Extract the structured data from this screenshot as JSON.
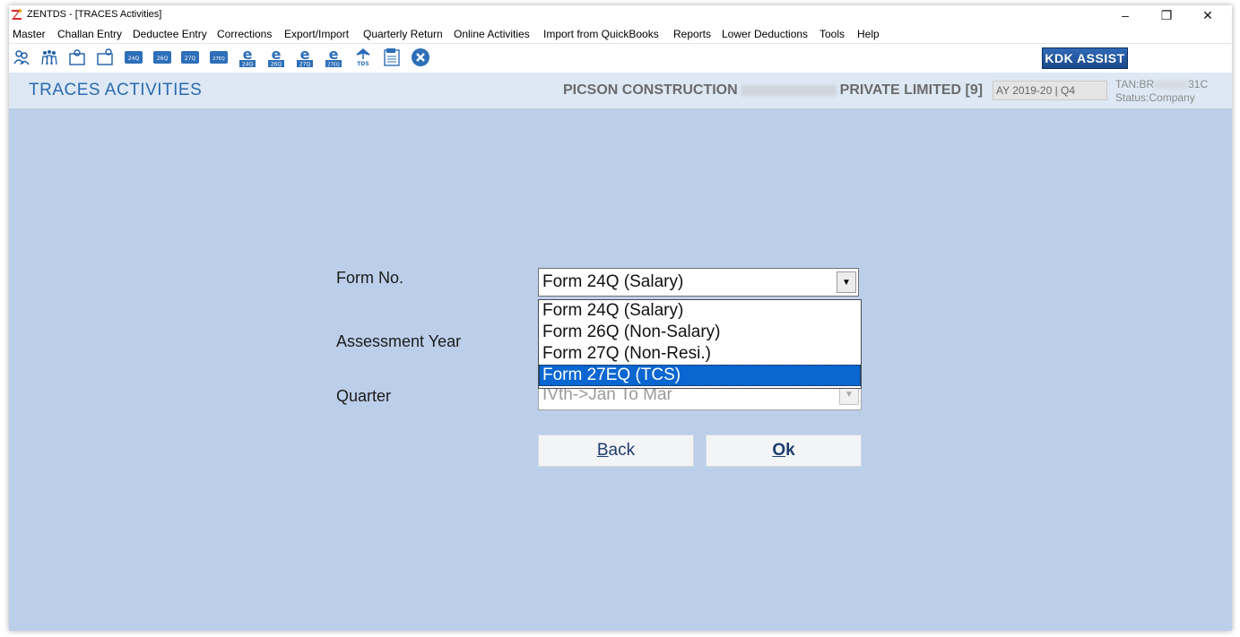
{
  "window": {
    "title": "ZENTDS - [TRACES Activities]",
    "controls": {
      "minimize": "–",
      "restore": "❐",
      "close": "✕"
    }
  },
  "menu": [
    "Master",
    "Challan Entry",
    "Deductee Entry",
    "Corrections",
    "Export/Import",
    "Quarterly Return",
    "Online Activities",
    "Import from QuickBooks",
    "Reports",
    "Lower Deductions",
    "Tools",
    "Help"
  ],
  "toolbar": {
    "icons": [
      "users-icon",
      "group-icon",
      "deductor-icon",
      "deductor-alt-icon",
      "form-24q-icon",
      "form-26q-icon",
      "form-27q-icon",
      "form-27eq-icon",
      "e-24q-icon",
      "e-26q-icon",
      "e-27q-icon",
      "e-27eq-icon",
      "tds-icon",
      "pdf-report-icon",
      "close-circle-icon"
    ],
    "icon_labels": [
      "",
      "",
      "",
      "",
      "24Q",
      "26Q",
      "27Q",
      "27EQ",
      "24Q",
      "26Q",
      "27Q",
      "27EQ",
      "TDS",
      "",
      ""
    ],
    "kdk_assist": "KDK ASSIST"
  },
  "header": {
    "page_title": "TRACES ACTIVITIES",
    "company_prefix": "PICSON CONSTRUCTION",
    "company_suffix": "PRIVATE LIMITED [9]",
    "ay_quarter": "AY 2019-20 | Q4",
    "tan_prefix": "TAN:BR",
    "tan_suffix": "31C",
    "status": "Status:Company"
  },
  "form": {
    "form_no_label": "Form No.",
    "form_no_value": "Form 24Q (Salary)",
    "form_options": [
      "Form 24Q (Salary)",
      "Form 26Q (Non-Salary)",
      "Form 27Q (Non-Resi.)",
      "Form 27EQ (TCS)"
    ],
    "highlighted_option_index": 3,
    "assessment_year_label": "Assessment Year",
    "quarter_label": "Quarter",
    "quarter_value": "IVth->Jan To Mar",
    "back_label_underlined": "B",
    "back_label_rest": "ack",
    "ok_label_underlined": "O",
    "ok_label_rest": "k"
  },
  "colors": {
    "content_bg": "#bccfea",
    "header_bg": "#dde8f4",
    "title_blue": "#2a6ab0",
    "selection_blue": "#0a66d0",
    "kdk_blue": "#1b4a8a"
  }
}
